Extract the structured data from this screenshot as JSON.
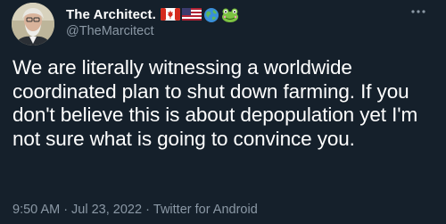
{
  "tweet": {
    "author": {
      "display_name": "The Architect.",
      "handle": "@TheMarcitect",
      "avatar_icon": "avatar-photo",
      "name_emojis": [
        "canada-flag-icon",
        "us-flag-icon",
        "globe-icon",
        "frog-icon"
      ]
    },
    "text": "We are literally witnessing a worldwide coordinated plan to shut down farming. If you don't believe this is about depopulation yet I'm not sure what is going to convince you.",
    "time": "9:50 AM",
    "date": "Jul 23, 2022",
    "source": "Twitter for Android",
    "separator": "·",
    "more_icon": "more-horizontal-icon"
  },
  "colors": {
    "background": "#15202b",
    "primary_text": "#ffffff",
    "secondary_text": "#8b98a5"
  }
}
